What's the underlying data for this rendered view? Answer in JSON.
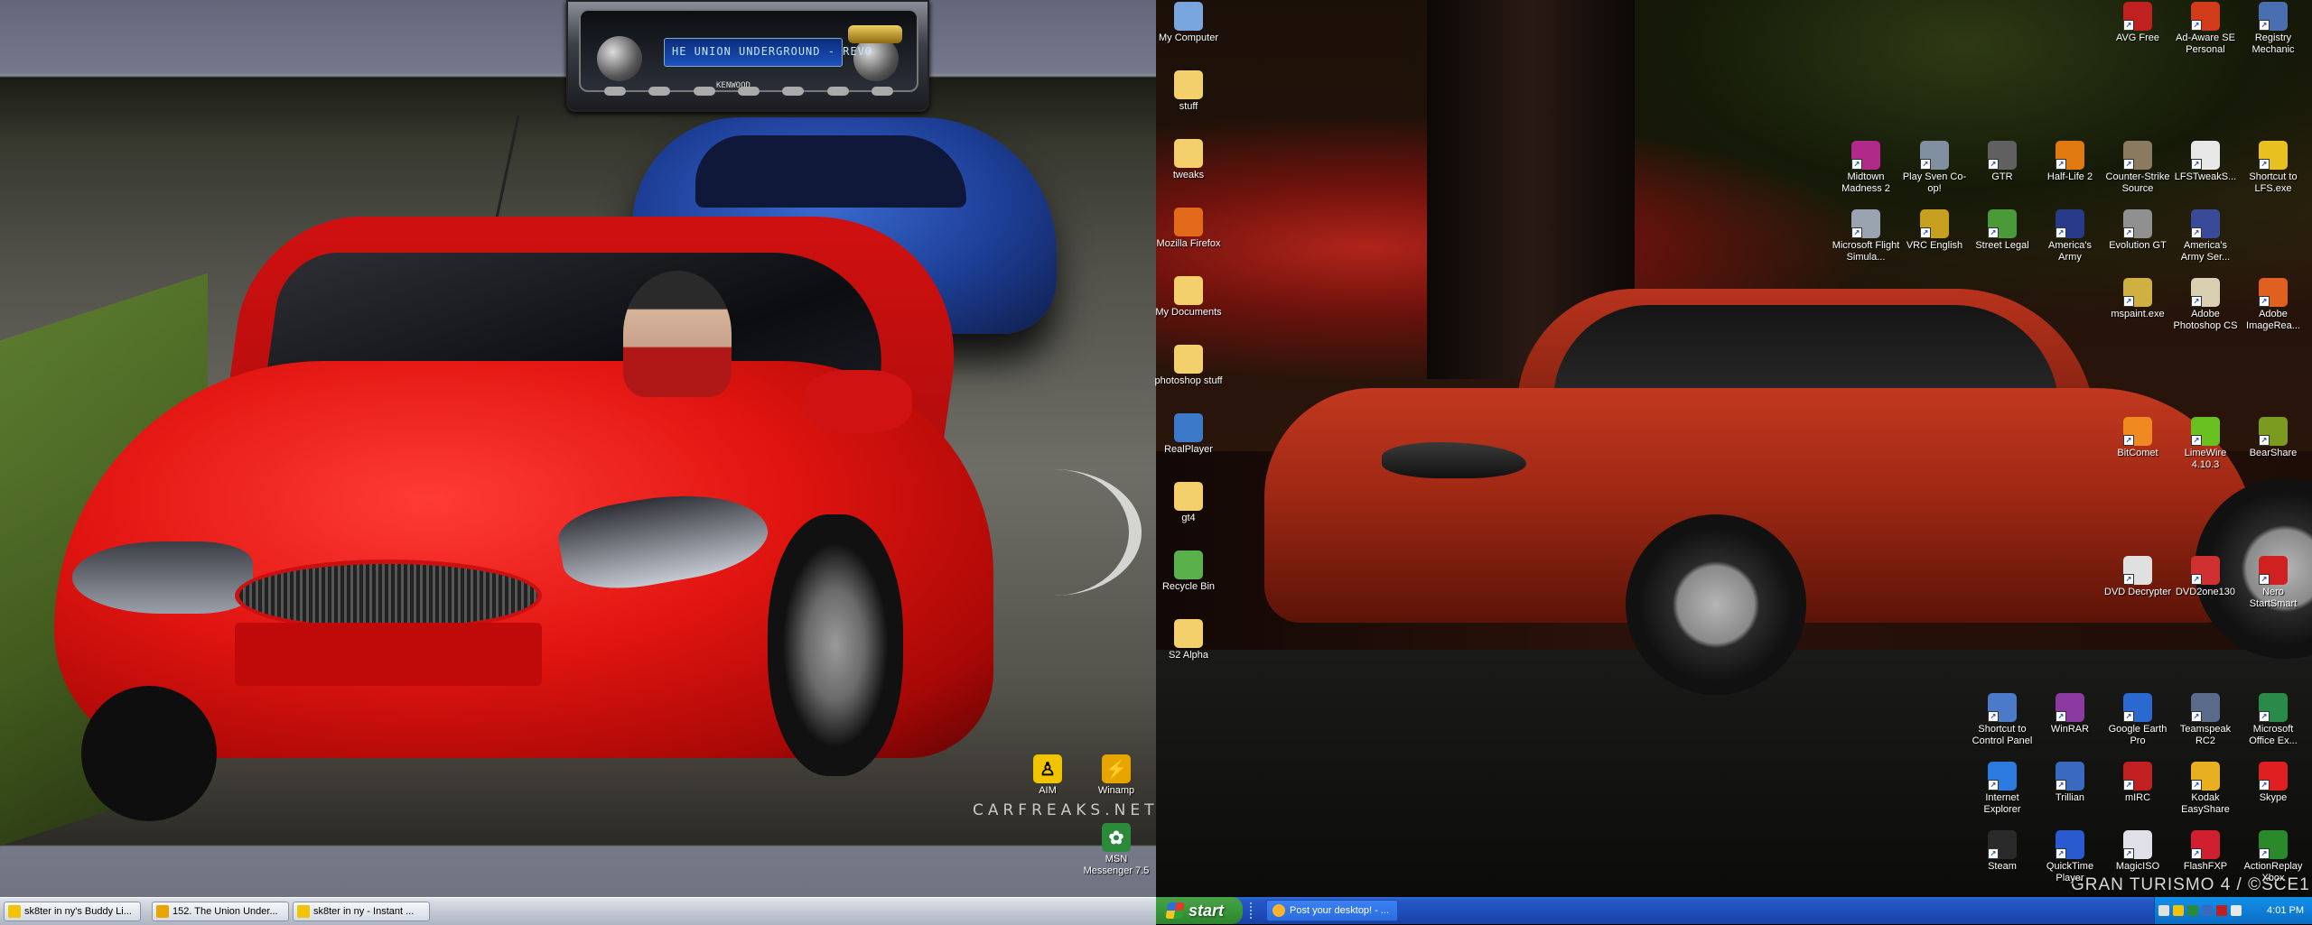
{
  "left_monitor": {
    "watermark": "CARFREAKS.NET",
    "stereo": {
      "lcd_text": "HE UNION UNDERGROUND - REVO",
      "brand": "KENWOOD"
    },
    "icons": [
      {
        "id": "aim",
        "label": "AIM",
        "icon": "aim-running-man-icon",
        "color": "#f0c400"
      },
      {
        "id": "winamp",
        "label": "Winamp",
        "icon": "winamp-bolt-icon",
        "color": "#e8a400"
      },
      {
        "id": "msn",
        "label": "MSN Messenger 7.5",
        "icon": "msn-butterfly-icon",
        "color": "#2a8a3a"
      }
    ],
    "taskbar": [
      {
        "label": "sk8ter in ny's Buddy Li...",
        "color": "#f2c400"
      },
      {
        "label": "152. The Union Under...",
        "color": "#e8a400"
      },
      {
        "label": "sk8ter in ny - Instant ...",
        "color": "#f2c400"
      }
    ]
  },
  "right_monitor": {
    "watermark": "GRAN TURISMO 4 / ©SCE1",
    "left_icons": [
      {
        "label": "My Computer",
        "icon": "my-computer-icon",
        "color": "#7aa6e0",
        "shortcut": false
      },
      {
        "label": "stuff",
        "icon": "folder-icon",
        "color": "#f3d06b",
        "shortcut": false
      },
      {
        "label": "tweaks",
        "icon": "folder-icon",
        "color": "#f3d06b",
        "shortcut": false
      },
      {
        "label": "Mozilla Firefox",
        "icon": "firefox-icon",
        "color": "#e46a1b",
        "shortcut": false
      },
      {
        "label": "My Documents",
        "icon": "my-documents-icon",
        "color": "#f3d06b",
        "shortcut": false
      },
      {
        "label": "photoshop stuff",
        "icon": "folder-icon",
        "color": "#f3d06b",
        "shortcut": false
      },
      {
        "label": "RealPlayer",
        "icon": "realplayer-icon",
        "color": "#3a7ac8",
        "shortcut": false
      },
      {
        "label": "gt4",
        "icon": "folder-icon",
        "color": "#f3d06b",
        "shortcut": false
      },
      {
        "label": "Recycle Bin",
        "icon": "recycle-bin-icon",
        "color": "#5ab04a",
        "shortcut": false
      },
      {
        "label": "S2 Alpha",
        "icon": "folder-icon",
        "color": "#f3d06b",
        "shortcut": false
      }
    ],
    "grid_icons": [
      {
        "label": "AVG Free",
        "icon": "avg-icon",
        "color": "#c02020"
      },
      {
        "label": "Ad-Aware SE Personal",
        "icon": "ad-aware-icon",
        "color": "#d23b1a"
      },
      {
        "label": "Registry Mechanic",
        "icon": "registry-mechanic-icon",
        "color": "#4a6fb0"
      },
      {
        "label": "Midtown Madness 2",
        "icon": "midtown-madness-icon",
        "color": "#b02a8a"
      },
      {
        "label": "Play Sven Co-op!",
        "icon": "sven-coop-icon",
        "color": "#8090a0"
      },
      {
        "label": "GTR",
        "icon": "gtr-icon",
        "color": "#606060"
      },
      {
        "label": "Half-Life 2",
        "icon": "half-life-icon",
        "color": "#e07a10"
      },
      {
        "label": "Counter-Strike Source",
        "icon": "counter-strike-icon",
        "color": "#8a7a60"
      },
      {
        "label": "LFSTweakS...",
        "icon": "document-icon",
        "color": "#e8e8e8"
      },
      {
        "label": "Shortcut to LFS.exe",
        "icon": "lfs-icon",
        "color": "#e8c020"
      },
      {
        "label": "Microsoft Flight Simula...",
        "icon": "flight-sim-icon",
        "color": "#9aa4b0"
      },
      {
        "label": "VRC English",
        "icon": "vrc-icon",
        "color": "#c8a020"
      },
      {
        "label": "Street Legal",
        "icon": "street-legal-icon",
        "color": "#4a9a3a"
      },
      {
        "label": "America's Army",
        "icon": "americas-army-icon",
        "color": "#2a3a8a"
      },
      {
        "label": "Evolution GT",
        "icon": "evolution-gt-icon",
        "color": "#909090"
      },
      {
        "label": "America's Army Ser...",
        "icon": "americas-army-server-icon",
        "color": "#3a4a9a"
      },
      {
        "label": "mspaint.exe",
        "icon": "mspaint-icon",
        "color": "#d0b040"
      },
      {
        "label": "Adobe Photoshop CS",
        "icon": "photoshop-icon",
        "color": "#d8d0b0"
      },
      {
        "label": "Adobe ImageRea...",
        "icon": "imageready-icon",
        "color": "#e06020"
      },
      {
        "label": "BitComet",
        "icon": "bitcomet-icon",
        "color": "#f08a20"
      },
      {
        "label": "LimeWire 4.10.3",
        "icon": "limewire-icon",
        "color": "#6ac020"
      },
      {
        "label": "BearShare",
        "icon": "bearshare-icon",
        "color": "#7a9a20"
      },
      {
        "label": "DVD Decrypter",
        "icon": "dvd-decrypter-icon",
        "color": "#e0e0e0"
      },
      {
        "label": "DVD2one130",
        "icon": "dvd2one-icon",
        "color": "#d03030"
      },
      {
        "label": "Nero StartSmart",
        "icon": "nero-icon",
        "color": "#d02020"
      },
      {
        "label": "Shortcut to Control Panel",
        "icon": "control-panel-icon",
        "color": "#4a7ac8"
      },
      {
        "label": "WinRAR",
        "icon": "winrar-icon",
        "color": "#8a3aa0"
      },
      {
        "label": "Google Earth Pro",
        "icon": "google-earth-icon",
        "color": "#2a6ad0"
      },
      {
        "label": "Teamspeak RC2",
        "icon": "teamspeak-icon",
        "color": "#5a6a8a"
      },
      {
        "label": "Microsoft Office Ex...",
        "icon": "office-icon",
        "color": "#2a8a4a"
      },
      {
        "label": "Internet Explorer",
        "icon": "internet-explorer-icon",
        "color": "#2a7ae0"
      },
      {
        "label": "Trillian",
        "icon": "trillian-icon",
        "color": "#3a6ac0"
      },
      {
        "label": "mIRC",
        "icon": "mirc-icon",
        "color": "#c02020"
      },
      {
        "label": "Kodak EasyShare",
        "icon": "kodak-icon",
        "color": "#e8b020"
      },
      {
        "label": "Skype",
        "icon": "skype-icon",
        "color": "#e02020"
      },
      {
        "label": "Steam",
        "icon": "steam-icon",
        "color": "#2a2a2a"
      },
      {
        "label": "QuickTime Player",
        "icon": "quicktime-icon",
        "color": "#2a5ad0"
      },
      {
        "label": "MagicISO",
        "icon": "magiciso-icon",
        "color": "#e0e0e8"
      },
      {
        "label": "FlashFXP",
        "icon": "flashfxp-icon",
        "color": "#d02030"
      },
      {
        "label": "ActionReplay Xbox",
        "icon": "actionreplay-icon",
        "color": "#2a8a2a"
      }
    ],
    "start_label": "start",
    "taskbar_button": "Post your desktop! - ...",
    "clock": "4:01 PM"
  }
}
